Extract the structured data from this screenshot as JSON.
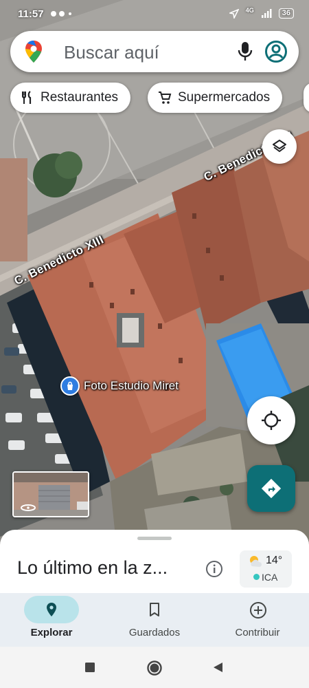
{
  "status_bar": {
    "time": "11:57",
    "network": "4G",
    "battery": "36"
  },
  "search": {
    "placeholder": "Buscar aquí",
    "icons": [
      "google-maps-logo",
      "microphone-icon",
      "account-icon"
    ]
  },
  "chips": [
    {
      "label": "Restaurantes",
      "icon": "fork-knife-icon"
    },
    {
      "label": "Supermercados",
      "icon": "shopping-cart-icon"
    }
  ],
  "map": {
    "street_labels": [
      "C. Benedicto XIII",
      "C. Benedicto XIII"
    ],
    "place": {
      "name": "Foto Estudio Miret",
      "icon": "shopping-bag-icon"
    },
    "layers_icon": "layers-icon",
    "my_location_icon": "crosshair-icon",
    "directions_icon": "turn-arrow-icon"
  },
  "bottom_sheet": {
    "title": "Lo último en la z...",
    "weather": {
      "temperature": "14°",
      "aqi_label": "ICA"
    }
  },
  "nav": {
    "items": [
      {
        "label": "Explorar",
        "icon": "location-pin-icon",
        "active": true
      },
      {
        "label": "Guardados",
        "icon": "bookmark-icon",
        "active": false
      },
      {
        "label": "Contribuir",
        "icon": "plus-circle-icon",
        "active": false
      }
    ]
  },
  "colors": {
    "accent": "#0d6f76",
    "nav_active_pill": "#b9e3ea",
    "pool": "#2b8be8"
  }
}
